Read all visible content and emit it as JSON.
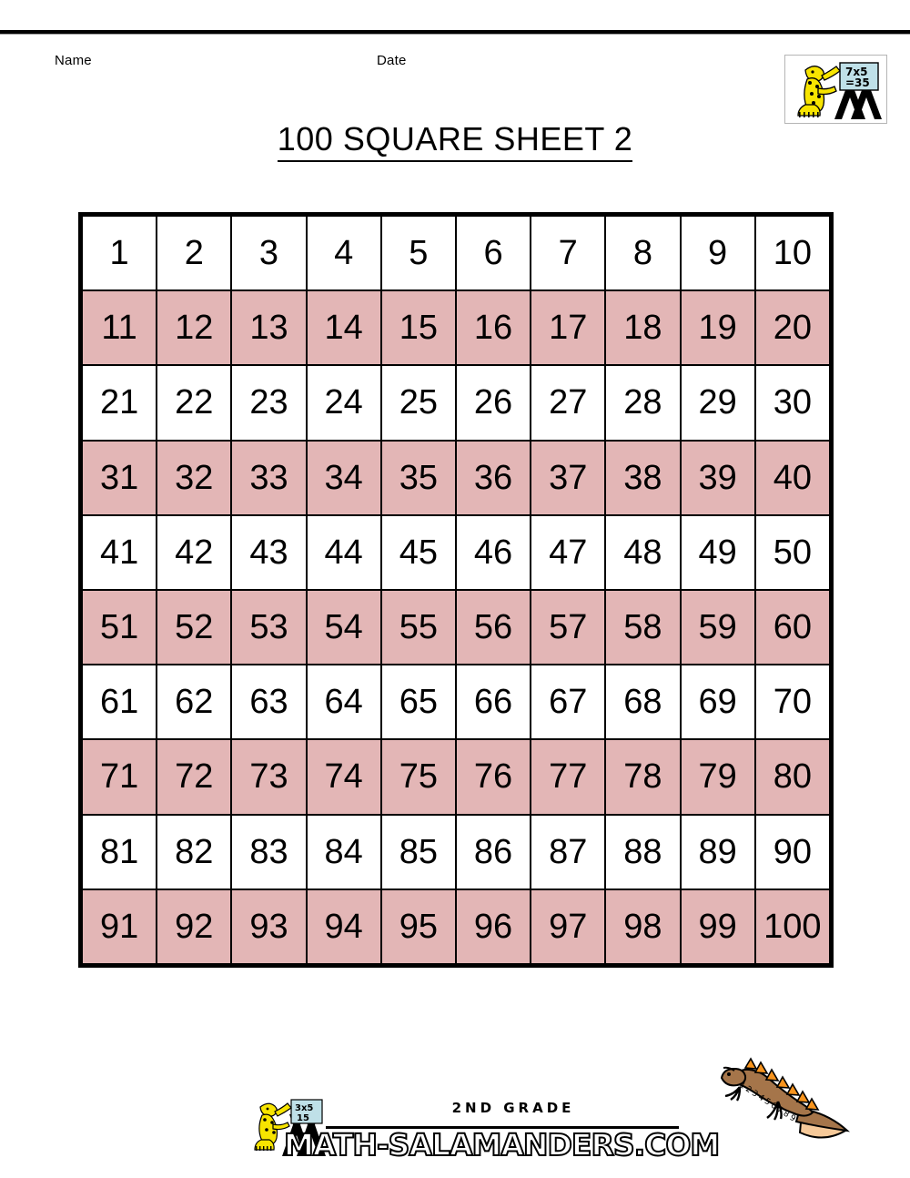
{
  "header": {
    "name_label": "Name",
    "date_label": "Date",
    "title": "100 SQUARE SHEET 2"
  },
  "logo": {
    "board_line1": "7x5",
    "board_line2": "=35",
    "alt": "math-salamanders-logo"
  },
  "grid": {
    "columns": 10,
    "rows": [
      {
        "tint": false,
        "values": [
          1,
          2,
          3,
          4,
          5,
          6,
          7,
          8,
          9,
          10
        ]
      },
      {
        "tint": true,
        "values": [
          11,
          12,
          13,
          14,
          15,
          16,
          17,
          18,
          19,
          20
        ]
      },
      {
        "tint": false,
        "values": [
          21,
          22,
          23,
          24,
          25,
          26,
          27,
          28,
          29,
          30
        ]
      },
      {
        "tint": true,
        "values": [
          31,
          32,
          33,
          34,
          35,
          36,
          37,
          38,
          39,
          40
        ]
      },
      {
        "tint": false,
        "values": [
          41,
          42,
          43,
          44,
          45,
          46,
          47,
          48,
          49,
          50
        ]
      },
      {
        "tint": true,
        "values": [
          51,
          52,
          53,
          54,
          55,
          56,
          57,
          58,
          59,
          60
        ]
      },
      {
        "tint": false,
        "values": [
          61,
          62,
          63,
          64,
          65,
          66,
          67,
          68,
          69,
          70
        ]
      },
      {
        "tint": true,
        "values": [
          71,
          72,
          73,
          74,
          75,
          76,
          77,
          78,
          79,
          80
        ]
      },
      {
        "tint": false,
        "values": [
          81,
          82,
          83,
          84,
          85,
          86,
          87,
          88,
          89,
          90
        ]
      },
      {
        "tint": true,
        "values": [
          91,
          92,
          93,
          94,
          95,
          96,
          97,
          98,
          99,
          100
        ]
      }
    ],
    "tint_color": "#e3b6b6",
    "plain_color": "#ffffff",
    "border_color": "#000000"
  },
  "footer": {
    "grade": "2ND GRADE",
    "url": "MATH-SALAMANDERS.COM",
    "logo_board_line1": "3x5",
    "logo_board_line2": "15"
  },
  "decoration": {
    "salamander_back_numbers": "123456789"
  }
}
